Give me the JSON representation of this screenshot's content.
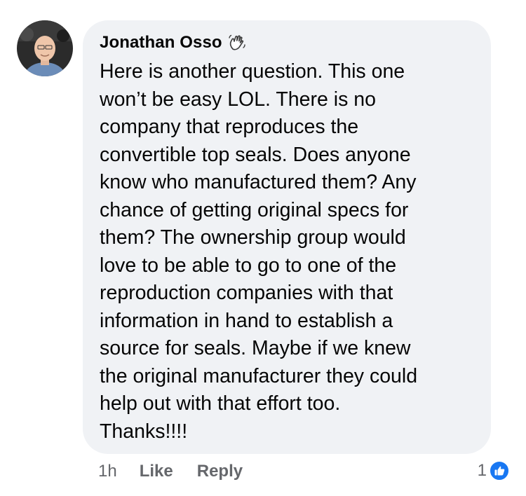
{
  "comment": {
    "author": "Jonathan Osso",
    "author_badge_icon": "waving-hand-icon",
    "text": "Here is another question.  This one\nwon’t be easy LOL.  There is no\ncompany that reproduces the\nconvertible top seals.  Does anyone\nknow who manufactured them?   Any\nchance of getting original specs for\nthem?   The ownership group would\nlove to be able to go to one of the\nreproduction companies with that\ninformation in hand to establish a\nsource for seals.  Maybe if we knew\nthe original manufacturer they could\nhelp out with that effort too.\nThanks!!!!"
  },
  "footer": {
    "time": "1h",
    "like_label": "Like",
    "reply_label": "Reply"
  },
  "reactions": {
    "count": "1",
    "icon": "thumbs-up-icon",
    "accent_color": "#1877f2"
  },
  "colors": {
    "bubble_background": "#f0f2f5",
    "secondary_text": "#65676b",
    "primary_text": "#050505"
  }
}
